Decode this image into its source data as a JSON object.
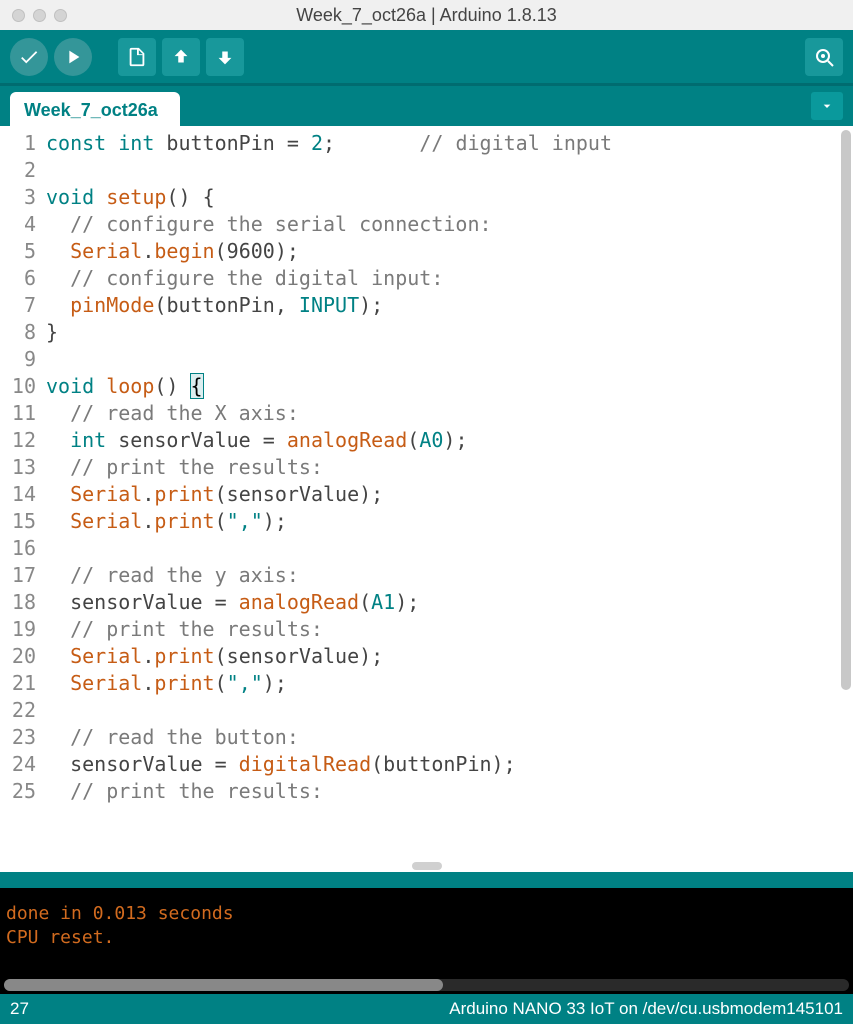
{
  "window": {
    "title": "Week_7_oct26a | Arduino 1.8.13"
  },
  "tab": {
    "label": "Week_7_oct26a"
  },
  "editor": {
    "lines": [
      {
        "n": 1,
        "tokens": [
          [
            "kw",
            "const"
          ],
          [
            "plain",
            " "
          ],
          [
            "kw",
            "int"
          ],
          [
            "plain",
            " buttonPin "
          ],
          [
            "punc",
            "="
          ],
          [
            "plain",
            " "
          ],
          [
            "const",
            "2"
          ],
          [
            "punc",
            ";"
          ],
          [
            "plain",
            "       "
          ],
          [
            "comment",
            "// digital input"
          ]
        ]
      },
      {
        "n": 2,
        "tokens": []
      },
      {
        "n": 3,
        "tokens": [
          [
            "kw",
            "void"
          ],
          [
            "plain",
            " "
          ],
          [
            "fn",
            "setup"
          ],
          [
            "punc",
            "()"
          ],
          [
            "plain",
            " "
          ],
          [
            "punc",
            "{"
          ]
        ]
      },
      {
        "n": 4,
        "tokens": [
          [
            "plain",
            "  "
          ],
          [
            "comment",
            "// configure the serial connection:"
          ]
        ]
      },
      {
        "n": 5,
        "tokens": [
          [
            "plain",
            "  "
          ],
          [
            "lib",
            "Serial"
          ],
          [
            "punc",
            "."
          ],
          [
            "fn",
            "begin"
          ],
          [
            "punc",
            "("
          ],
          [
            "plain",
            "9600"
          ],
          [
            "punc",
            ");"
          ]
        ]
      },
      {
        "n": 6,
        "tokens": [
          [
            "plain",
            "  "
          ],
          [
            "comment",
            "// configure the digital input:"
          ]
        ]
      },
      {
        "n": 7,
        "tokens": [
          [
            "plain",
            "  "
          ],
          [
            "fn",
            "pinMode"
          ],
          [
            "punc",
            "("
          ],
          [
            "plain",
            "buttonPin"
          ],
          [
            "punc",
            ", "
          ],
          [
            "const",
            "INPUT"
          ],
          [
            "punc",
            ");"
          ]
        ]
      },
      {
        "n": 8,
        "tokens": [
          [
            "punc",
            "}"
          ]
        ]
      },
      {
        "n": 9,
        "tokens": []
      },
      {
        "n": 10,
        "tokens": [
          [
            "kw",
            "void"
          ],
          [
            "plain",
            " "
          ],
          [
            "fn",
            "loop"
          ],
          [
            "punc",
            "()"
          ],
          [
            "plain",
            " "
          ],
          [
            "highlight-brace",
            "{"
          ]
        ]
      },
      {
        "n": 11,
        "tokens": [
          [
            "plain",
            "  "
          ],
          [
            "comment",
            "// read the X axis:"
          ]
        ]
      },
      {
        "n": 12,
        "tokens": [
          [
            "plain",
            "  "
          ],
          [
            "kw",
            "int"
          ],
          [
            "plain",
            " sensorValue "
          ],
          [
            "punc",
            "= "
          ],
          [
            "fn",
            "analogRead"
          ],
          [
            "punc",
            "("
          ],
          [
            "const",
            "A0"
          ],
          [
            "punc",
            ");"
          ]
        ]
      },
      {
        "n": 13,
        "tokens": [
          [
            "plain",
            "  "
          ],
          [
            "comment",
            "// print the results:"
          ]
        ]
      },
      {
        "n": 14,
        "tokens": [
          [
            "plain",
            "  "
          ],
          [
            "lib",
            "Serial"
          ],
          [
            "punc",
            "."
          ],
          [
            "fn",
            "print"
          ],
          [
            "punc",
            "("
          ],
          [
            "plain",
            "sensorValue"
          ],
          [
            "punc",
            ");"
          ]
        ]
      },
      {
        "n": 15,
        "tokens": [
          [
            "plain",
            "  "
          ],
          [
            "lib",
            "Serial"
          ],
          [
            "punc",
            "."
          ],
          [
            "fn",
            "print"
          ],
          [
            "punc",
            "("
          ],
          [
            "str",
            "\",\""
          ],
          [
            "punc",
            ");"
          ]
        ]
      },
      {
        "n": 16,
        "tokens": []
      },
      {
        "n": 17,
        "tokens": [
          [
            "plain",
            "  "
          ],
          [
            "comment",
            "// read the y axis:"
          ]
        ]
      },
      {
        "n": 18,
        "tokens": [
          [
            "plain",
            "  sensorValue "
          ],
          [
            "punc",
            "= "
          ],
          [
            "fn",
            "analogRead"
          ],
          [
            "punc",
            "("
          ],
          [
            "const",
            "A1"
          ],
          [
            "punc",
            ");"
          ]
        ]
      },
      {
        "n": 19,
        "tokens": [
          [
            "plain",
            "  "
          ],
          [
            "comment",
            "// print the results:"
          ]
        ]
      },
      {
        "n": 20,
        "tokens": [
          [
            "plain",
            "  "
          ],
          [
            "lib",
            "Serial"
          ],
          [
            "punc",
            "."
          ],
          [
            "fn",
            "print"
          ],
          [
            "punc",
            "("
          ],
          [
            "plain",
            "sensorValue"
          ],
          [
            "punc",
            ");"
          ]
        ]
      },
      {
        "n": 21,
        "tokens": [
          [
            "plain",
            "  "
          ],
          [
            "lib",
            "Serial"
          ],
          [
            "punc",
            "."
          ],
          [
            "fn",
            "print"
          ],
          [
            "punc",
            "("
          ],
          [
            "str",
            "\",\""
          ],
          [
            "punc",
            ");"
          ]
        ]
      },
      {
        "n": 22,
        "tokens": []
      },
      {
        "n": 23,
        "tokens": [
          [
            "plain",
            "  "
          ],
          [
            "comment",
            "// read the button:"
          ]
        ]
      },
      {
        "n": 24,
        "tokens": [
          [
            "plain",
            "  sensorValue "
          ],
          [
            "punc",
            "= "
          ],
          [
            "fn",
            "digitalRead"
          ],
          [
            "punc",
            "("
          ],
          [
            "plain",
            "buttonPin"
          ],
          [
            "punc",
            ");"
          ]
        ]
      },
      {
        "n": 25,
        "tokens": [
          [
            "plain",
            "  "
          ],
          [
            "comment",
            "// print the results:"
          ]
        ]
      }
    ]
  },
  "console": {
    "lines": [
      "done in 0.013 seconds",
      "CPU reset."
    ]
  },
  "status": {
    "line": "27",
    "board": "Arduino NANO 33 IoT on /dev/cu.usbmodem145101"
  }
}
